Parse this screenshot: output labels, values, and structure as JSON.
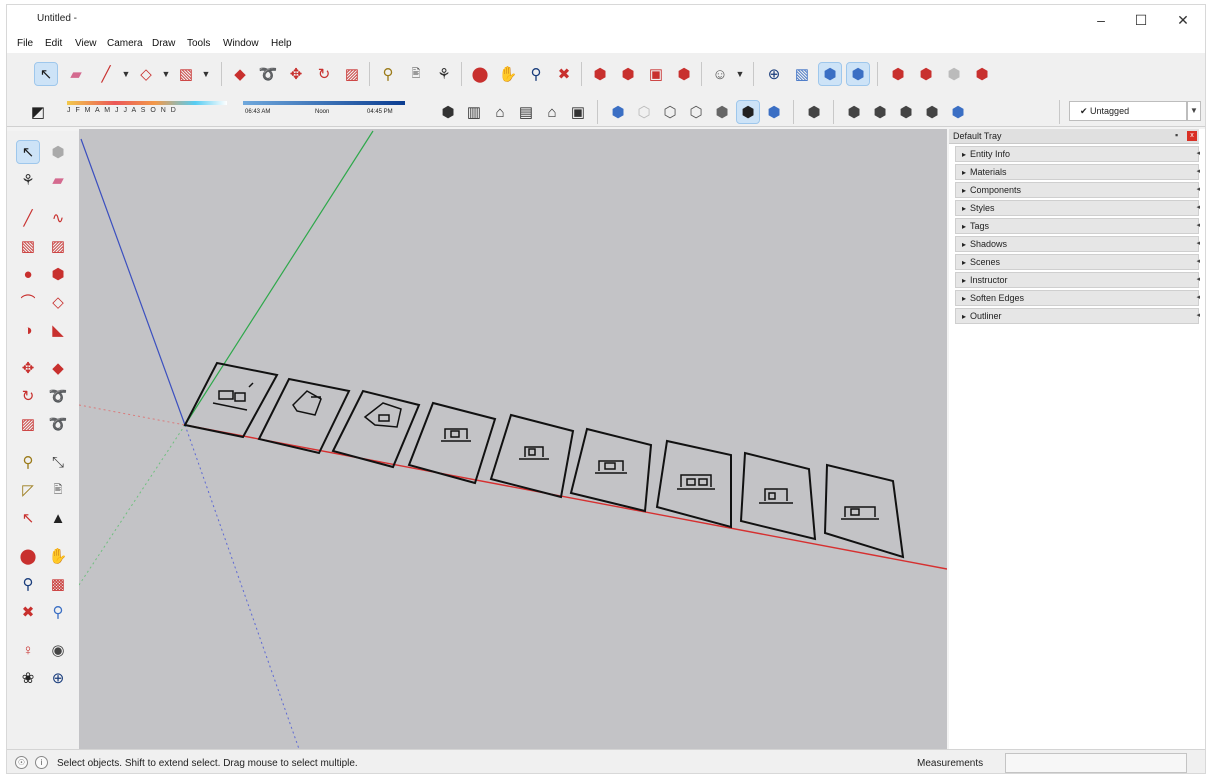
{
  "window": {
    "title": "Untitled -",
    "controls": {
      "minimize": "–",
      "maximize": "☐",
      "close": "✕"
    }
  },
  "menu": [
    "File",
    "Edit",
    "View",
    "Camera",
    "Draw",
    "Tools",
    "Window",
    "Help"
  ],
  "toolbar": {
    "shadow_months": "J F M A M J J A S O N D",
    "time_start": "06:43 AM",
    "time_noon": "Noon",
    "time_end": "04:45 PM",
    "tag_value": "✔ Untagged"
  },
  "tray": {
    "title": "Default Tray",
    "pin": "▪",
    "close": "x",
    "panels": [
      "Entity Info",
      "Materials",
      "Components",
      "Styles",
      "Tags",
      "Shadows",
      "Scenes",
      "Instructor",
      "Soften Edges",
      "Outliner"
    ]
  },
  "status": {
    "hint": "Select objects. Shift to extend select. Drag mouse to select multiple.",
    "measurements_label": "Measurements",
    "measurements_value": ""
  },
  "colors": {
    "viewport_bg": "#c3c3c6",
    "axis_red": "#d63030",
    "axis_green": "#2ea84b",
    "axis_blue": "#3b4fbf",
    "tool_red": "#c8302e",
    "tool_select": "#cde3f7"
  }
}
